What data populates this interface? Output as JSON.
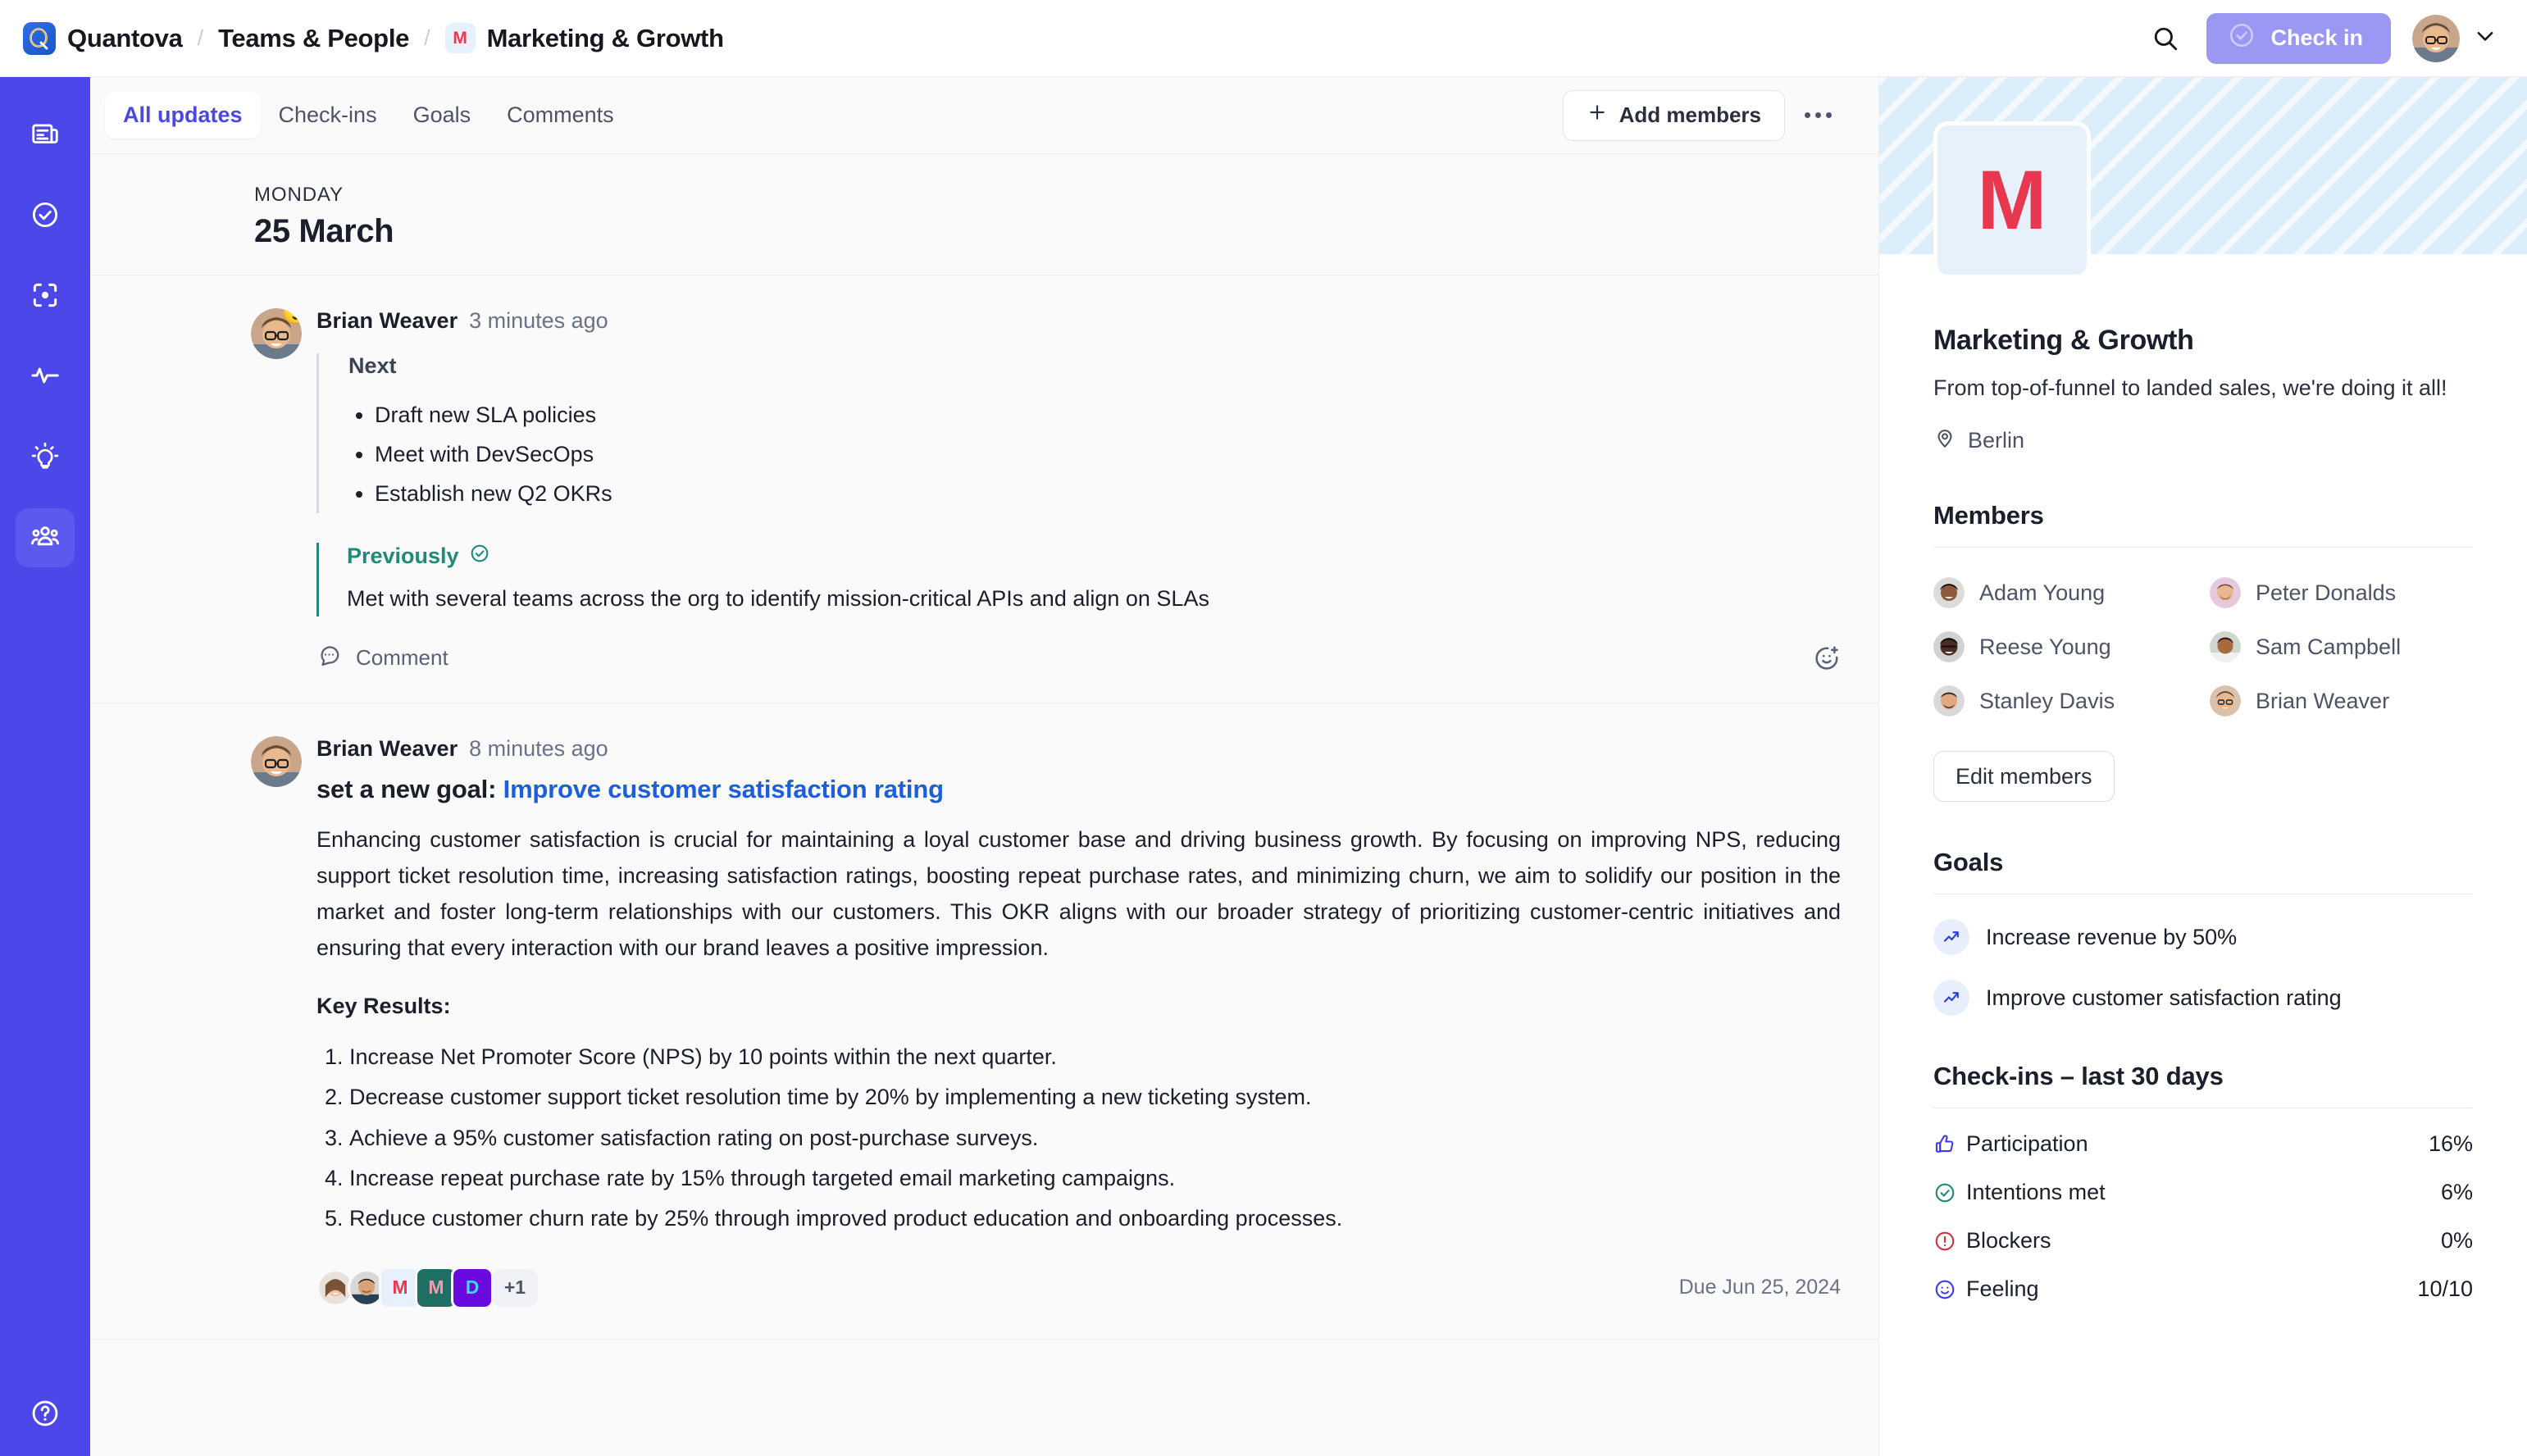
{
  "header": {
    "brand": "Quantova",
    "logo_icon": "quantova-logo",
    "breadcrumb": [
      "Teams & People",
      "Marketing & Growth"
    ],
    "team_initial": "M",
    "search_icon": "search-icon",
    "checkin_label": "Check in",
    "checkin_icon": "check-circle-icon",
    "checkin_color": "#9a98f2",
    "avatar_chevron_icon": "chevron-down-icon"
  },
  "rail": {
    "items": [
      {
        "icon": "newspaper-icon",
        "name": "updates",
        "active": false
      },
      {
        "icon": "check-circle-icon",
        "name": "checkins",
        "active": false
      },
      {
        "icon": "focus-target-icon",
        "name": "focus",
        "active": false
      },
      {
        "icon": "activity-pulse-icon",
        "name": "activity",
        "active": false
      },
      {
        "icon": "lightbulb-icon",
        "name": "insights",
        "active": false
      },
      {
        "icon": "people-group-icon",
        "name": "teams",
        "active": true
      }
    ],
    "help_icon": "help-circle-icon",
    "background": "#4b47e8"
  },
  "tabs": {
    "items": [
      "All updates",
      "Check-ins",
      "Goals",
      "Comments"
    ],
    "active_index": 0,
    "add_members_label": "Add members",
    "add_icon": "plus-icon",
    "more_icon": "ellipsis-icon"
  },
  "feed": {
    "day_kicker": "MONDAY",
    "day_date": "25 March",
    "posts": [
      {
        "author": "Brian Weaver",
        "ago": "3 minutes ago",
        "emoji": "😌",
        "next_title": "Next",
        "next_items": [
          "Draft new SLA policies",
          "Meet with DevSecOps",
          "Establish new Q2 OKRs"
        ],
        "previously_title": "Previously",
        "previously_icon": "check-circle-icon",
        "previously_text": "Met with several teams across the org to identify mission-critical APIs and align on SLAs",
        "comment_label": "Comment",
        "comment_icon": "comment-dots-icon",
        "react_icon": "add-reaction-icon"
      },
      {
        "author": "Brian Weaver",
        "ago": "8 minutes ago",
        "goal_prefix": "set a new goal:",
        "goal_link": "Improve customer satisfaction rating",
        "paragraph": "Enhancing customer satisfaction is crucial for maintaining a loyal customer base and driving business growth. By focusing on improving NPS, reducing support ticket resolution time, increasing satisfaction ratings, boosting repeat purchase rates, and minimizing churn, we aim to solidify our position in the market and foster long-term relationships with our customers. This OKR aligns with our broader strategy of prioritizing customer-centric initiatives and ensuring that every interaction with our brand leaves a positive impression.",
        "kr_title": "Key Results:",
        "key_results": [
          "Increase Net Promoter Score (NPS) by 10 points within the next quarter.",
          "Decrease customer support ticket resolution time by 20% by implementing a new ticketing system.",
          "Achieve a 95% customer satisfaction rating on post-purchase surveys.",
          "Increase repeat purchase rate by 15% through targeted email marketing campaigns.",
          "Reduce customer churn rate by 25% through improved product education and onboarding processes."
        ],
        "chips": [
          {
            "letter": "M",
            "bg": "#e7f1fb",
            "fg": "#e8384f"
          },
          {
            "letter": "M",
            "bg": "#1f6f64",
            "fg": "#f49ab0"
          },
          {
            "letter": "D",
            "bg": "#6b0ae0",
            "fg": "#3fd8f5"
          }
        ],
        "overflow": "+1",
        "due": "Due Jun 25, 2024"
      }
    ]
  },
  "panel": {
    "team_initial": "M",
    "team_initial_color": "#e8384f",
    "team_name": "Marketing & Growth",
    "team_desc": "From top-of-funnel to landed sales, we're doing it all!",
    "location": "Berlin",
    "location_icon": "map-pin-icon",
    "members_title": "Members",
    "members": [
      "Adam Young",
      "Peter Donalds",
      "Reese Young",
      "Sam Campbell",
      "Stanley Davis",
      "Brian Weaver"
    ],
    "edit_members_label": "Edit members",
    "goals_title": "Goals",
    "goals": [
      {
        "label": "Increase revenue by 50%",
        "icon": "trend-up-icon"
      },
      {
        "label": "Improve customer satisfaction rating",
        "icon": "trend-up-icon"
      }
    ],
    "checkins_title": "Check-ins – last 30 days",
    "stats": [
      {
        "label": "Participation",
        "value": "16%",
        "icon": "thumbs-up-icon",
        "color": "#3d3af0"
      },
      {
        "label": "Intentions met",
        "value": "6%",
        "icon": "check-circle-icon",
        "color": "#1f8a7a"
      },
      {
        "label": "Blockers",
        "value": "0%",
        "icon": "alert-circle-icon",
        "color": "#d32f3f"
      },
      {
        "label": "Feeling",
        "value": "10/10",
        "icon": "smiley-icon",
        "color": "#3d3af0"
      }
    ]
  }
}
